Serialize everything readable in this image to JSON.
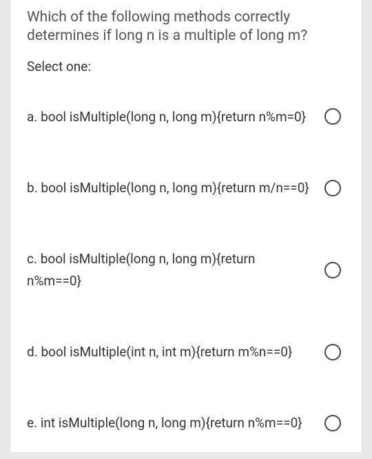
{
  "question": {
    "text": "Which of the following methods correctly determines if long n is a multiple of long m?",
    "instruction": "Select one:"
  },
  "options": [
    {
      "letter": "a.",
      "code": "bool isMultiple(long n, long m){return n%m=0}"
    },
    {
      "letter": "b.",
      "code": "bool isMultiple(long n, long m){return m/n==0}"
    },
    {
      "letter": "c.",
      "code": "bool isMultiple(long n, long m){return n%m==0}"
    },
    {
      "letter": "d.",
      "code": "bool isMultiple(int n, int m){return m%n==0}"
    },
    {
      "letter": "e.",
      "code": "int isMultiple(long n, long m){return n%m==0}"
    }
  ]
}
